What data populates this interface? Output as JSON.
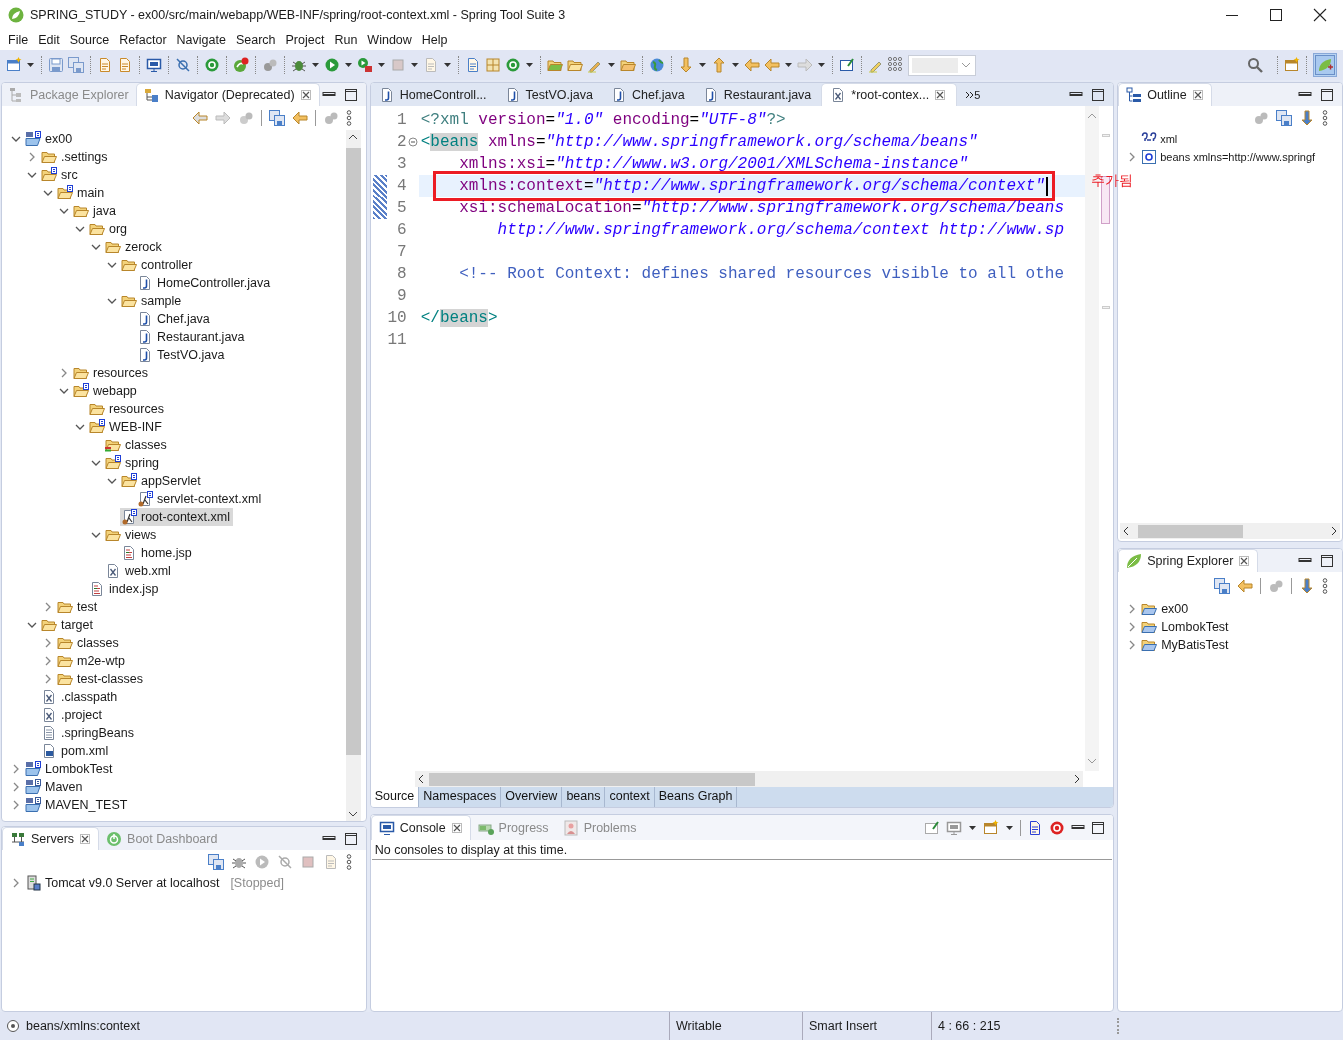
{
  "window": {
    "title": "SPRING_STUDY - ex00/src/main/webapp/WEB-INF/spring/root-context.xml - Spring Tool Suite 3"
  },
  "menu": [
    "File",
    "Edit",
    "Source",
    "Refactor",
    "Navigate",
    "Search",
    "Project",
    "Run",
    "Window",
    "Help"
  ],
  "left_panel": {
    "tabs": [
      {
        "label": "Package Explorer",
        "selected": false
      },
      {
        "label": "Navigator (Deprecated)",
        "selected": true
      }
    ],
    "tree": [
      {
        "label": "ex00",
        "kind": "project",
        "expanded": true,
        "selected": false,
        "children": [
          {
            "label": ".settings",
            "kind": "folder",
            "expanded": false,
            "selected": false
          },
          {
            "label": "src",
            "kind": "sfolder",
            "expanded": true,
            "selected": false,
            "children": [
              {
                "label": "main",
                "kind": "sfolder",
                "expanded": true,
                "selected": false,
                "children": [
                  {
                    "label": "java",
                    "kind": "folder",
                    "expanded": true,
                    "selected": false,
                    "children": [
                      {
                        "label": "org",
                        "kind": "folder",
                        "expanded": true,
                        "selected": false,
                        "children": [
                          {
                            "label": "zerock",
                            "kind": "folder",
                            "expanded": true,
                            "selected": false,
                            "children": [
                              {
                                "label": "controller",
                                "kind": "folder",
                                "expanded": true,
                                "selected": false,
                                "children": [
                                  {
                                    "label": "HomeController.java",
                                    "kind": "java",
                                    "selected": false
                                  }
                                ]
                              },
                              {
                                "label": "sample",
                                "kind": "folder",
                                "expanded": true,
                                "selected": false,
                                "children": [
                                  {
                                    "label": "Chef.java",
                                    "kind": "java",
                                    "selected": false
                                  },
                                  {
                                    "label": "Restaurant.java",
                                    "kind": "java",
                                    "selected": false
                                  },
                                  {
                                    "label": "TestVO.java",
                                    "kind": "java",
                                    "selected": false
                                  }
                                ]
                              }
                            ]
                          }
                        ]
                      }
                    ]
                  },
                  {
                    "label": "resources",
                    "kind": "folder",
                    "expanded": false,
                    "selected": false
                  },
                  {
                    "label": "webapp",
                    "kind": "sfolder",
                    "expanded": true,
                    "selected": false,
                    "children": [
                      {
                        "label": "resources",
                        "kind": "folder",
                        "selected": false
                      },
                      {
                        "label": "WEB-INF",
                        "kind": "sfolder",
                        "expanded": true,
                        "selected": false,
                        "children": [
                          {
                            "label": "classes",
                            "kind": "classes",
                            "selected": false
                          },
                          {
                            "label": "spring",
                            "kind": "sfolder",
                            "expanded": true,
                            "selected": false,
                            "children": [
                              {
                                "label": "appServlet",
                                "kind": "sfolder",
                                "expanded": true,
                                "selected": false,
                                "children": [
                                  {
                                    "label": "servlet-context.xml",
                                    "kind": "sxml",
                                    "selected": false
                                  }
                                ]
                              },
                              {
                                "label": "root-context.xml",
                                "kind": "sxml",
                                "selected": true
                              }
                            ]
                          },
                          {
                            "label": "views",
                            "kind": "folder",
                            "expanded": true,
                            "selected": false,
                            "children": [
                              {
                                "label": "home.jsp",
                                "kind": "jsp",
                                "selected": false
                              }
                            ]
                          },
                          {
                            "label": "web.xml",
                            "kind": "xml",
                            "selected": false
                          }
                        ]
                      },
                      {
                        "label": "index.jsp",
                        "kind": "jsp",
                        "selected": false
                      }
                    ]
                  }
                ]
              },
              {
                "label": "test",
                "kind": "folder",
                "expanded": false,
                "selected": false
              }
            ]
          },
          {
            "label": "target",
            "kind": "folder",
            "expanded": true,
            "selected": false,
            "children": [
              {
                "label": "classes",
                "kind": "folder",
                "expanded": false,
                "selected": false
              },
              {
                "label": "m2e-wtp",
                "kind": "folder",
                "expanded": false,
                "selected": false
              },
              {
                "label": "test-classes",
                "kind": "folder",
                "expanded": false,
                "selected": false
              }
            ]
          },
          {
            "label": ".classpath",
            "kind": "xml",
            "selected": false
          },
          {
            "label": ".project",
            "kind": "xml",
            "selected": false
          },
          {
            "label": ".springBeans",
            "kind": "text",
            "selected": false
          },
          {
            "label": "pom.xml",
            "kind": "pom",
            "selected": false
          }
        ]
      },
      {
        "label": "LombokTest",
        "kind": "project",
        "expanded": false,
        "selected": false
      },
      {
        "label": "Maven",
        "kind": "java-project",
        "expanded": false,
        "selected": false
      },
      {
        "label": "MAVEN_TEST",
        "kind": "java-project",
        "expanded": false,
        "selected": false
      }
    ]
  },
  "servers_panel": {
    "tabs": [
      {
        "label": "Servers",
        "selected": true
      },
      {
        "label": "Boot Dashboard",
        "selected": false
      }
    ],
    "tree": [
      {
        "label": "Tomcat v9.0 Server at localhost",
        "kind": "server",
        "status": "[Stopped]",
        "expanded": false,
        "selected": false
      }
    ]
  },
  "editor": {
    "tabs": [
      {
        "label": "HomeControll...",
        "kind": "java",
        "selected": false
      },
      {
        "label": "TestVO.java",
        "kind": "java",
        "selected": false
      },
      {
        "label": "Chef.java",
        "kind": "java",
        "selected": false
      },
      {
        "label": "Restaurant.java",
        "kind": "java",
        "selected": false
      },
      {
        "label": "*root-contex...",
        "kind": "xml",
        "selected": true
      }
    ],
    "hidden_tabs": "5",
    "lines": [
      {
        "number": "1",
        "tokens": [
          {
            "kind": "pi",
            "text": "<?xml"
          },
          {
            "kind": "attr",
            "text": " version"
          },
          {
            "kind": "plain",
            "text": "="
          },
          {
            "kind": "value",
            "text": "\"1.0\""
          },
          {
            "kind": "attr",
            "text": " encoding"
          },
          {
            "kind": "plain",
            "text": "="
          },
          {
            "kind": "value",
            "text": "\"UTF-8\""
          },
          {
            "kind": "pi",
            "text": "?>"
          }
        ]
      },
      {
        "number": "2",
        "foldable": true,
        "tokens": [
          {
            "kind": "tag",
            "text": "<"
          },
          {
            "kind": "tag",
            "text": "beans",
            "highlight": true
          },
          {
            "kind": "attr",
            "text": " xmlns"
          },
          {
            "kind": "plain",
            "text": "="
          },
          {
            "kind": "value",
            "text": "\"http://www.springframework.org/schema/beans\""
          }
        ]
      },
      {
        "number": "3",
        "tokens": [
          {
            "kind": "attr",
            "text": "    xmlns:xsi"
          },
          {
            "kind": "plain",
            "text": "="
          },
          {
            "kind": "value",
            "text": "\"http://www.w3.org/2001/XMLSchema-instance\""
          }
        ]
      },
      {
        "number": "4",
        "current": true,
        "changed": true,
        "marked": true,
        "cursor": true,
        "tokens": [
          {
            "kind": "attr",
            "text": "    xmlns:context"
          },
          {
            "kind": "plain",
            "text": "="
          },
          {
            "kind": "value",
            "text": "\"http://www.springframework.org/schema/context\""
          }
        ]
      },
      {
        "number": "5",
        "changed": true,
        "tokens": [
          {
            "kind": "attr",
            "text": "    xsi:schemaLocation"
          },
          {
            "kind": "plain",
            "text": "="
          },
          {
            "kind": "value",
            "text": "\"http://www.springframework.org/schema/beans"
          }
        ]
      },
      {
        "number": "6",
        "tokens": [
          {
            "kind": "value",
            "text": "        http://www.springframework.org/schema/context http://www.sp"
          }
        ]
      },
      {
        "number": "7"
      },
      {
        "number": "8",
        "tokens": [
          {
            "kind": "comment",
            "text": "    <!-- Root Context: defines shared resources visible to all othe"
          }
        ]
      },
      {
        "number": "9"
      },
      {
        "number": "10",
        "tokens": [
          {
            "kind": "tag",
            "text": "</"
          },
          {
            "kind": "tag",
            "text": "beans",
            "highlight": true
          },
          {
            "kind": "tag",
            "text": ">"
          }
        ]
      },
      {
        "number": "11"
      }
    ],
    "annotation": "추가됨",
    "page_tabs": [
      {
        "label": "Source",
        "selected": true
      },
      {
        "label": "Namespaces",
        "selected": false
      },
      {
        "label": "Overview",
        "selected": false
      },
      {
        "label": "beans",
        "selected": false
      },
      {
        "label": "context",
        "selected": false
      },
      {
        "label": "Beans Graph",
        "selected": false
      }
    ]
  },
  "console_panel": {
    "tabs": [
      {
        "label": "Console",
        "selected": true
      },
      {
        "label": "Progress",
        "selected": false
      },
      {
        "label": "Problems",
        "selected": false
      }
    ],
    "message": "No consoles to display at this time."
  },
  "outline_panel": {
    "tabs": [
      {
        "label": "Outline",
        "selected": true
      }
    ],
    "tree": [
      {
        "label": "xml",
        "kind": "pi",
        "selected": false
      },
      {
        "label": "beans xmlns=http://www.springf",
        "kind": "element",
        "expanded": false,
        "selected": false
      }
    ]
  },
  "spring_explorer": {
    "tabs": [
      {
        "label": "Spring Explorer",
        "selected": true
      }
    ],
    "tree": [
      {
        "label": "ex00",
        "kind": "sproject",
        "expanded": false,
        "selected": false
      },
      {
        "label": "LombokTest",
        "kind": "sproject",
        "expanded": false,
        "selected": false
      },
      {
        "label": "MyBatisTest",
        "kind": "sproject",
        "expanded": false,
        "selected": false
      }
    ]
  },
  "status_bar": {
    "path": "beans/xmlns:context",
    "mode": "Writable",
    "insert_mode": "Smart Insert",
    "position": "4 : 66 : 215"
  }
}
